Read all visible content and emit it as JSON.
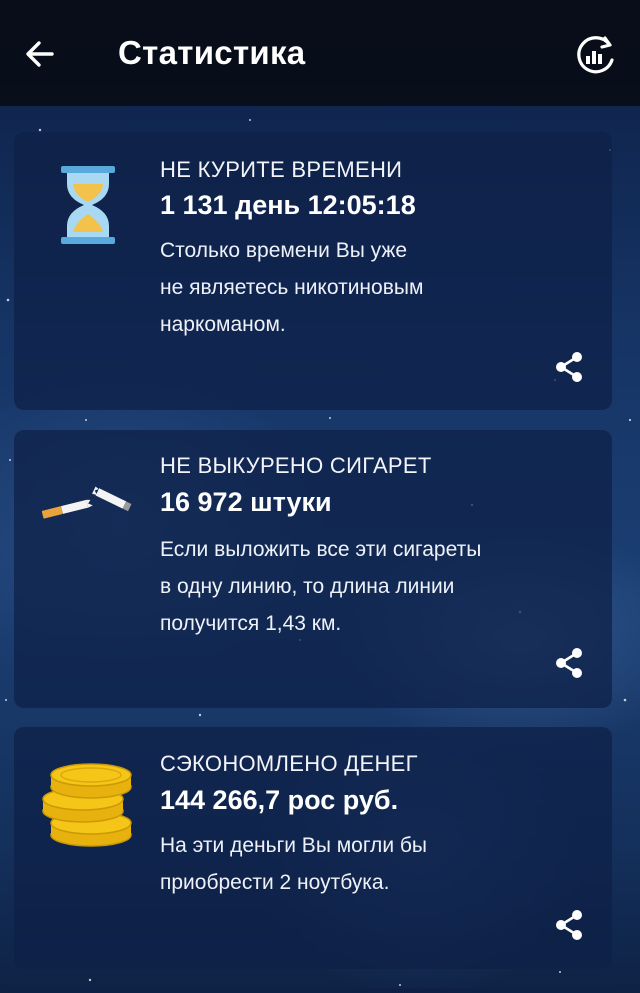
{
  "header": {
    "title": "Статистика",
    "back_icon": "arrow-back-icon",
    "action_icon": "refresh-chart-icon"
  },
  "cards": [
    {
      "icon": "hourglass-icon",
      "heading": "НЕ КУРИТЕ ВРЕМЕНИ",
      "value": "1 131 день 12:05:18",
      "description": [
        "Столько времени Вы уже",
        "не являетесь никотиновым",
        "наркоманом."
      ],
      "share_icon": "share-icon"
    },
    {
      "icon": "broken-cigarette-icon",
      "heading": "НЕ ВЫКУРЕНО СИГАРЕТ",
      "value": "16 972 штуки",
      "description": [
        "Если выложить все эти сигареты",
        "в одну линию, то длина линии",
        "получится 1,43 км."
      ],
      "share_icon": "share-icon"
    },
    {
      "icon": "coins-stack-icon",
      "heading": "СЭКОНОМЛЕНО ДЕНЕГ",
      "value": "144 266,7 рос руб.",
      "description": [
        "На эти деньги Вы могли бы",
        "приобрести 2 ноутбука."
      ],
      "share_icon": "share-icon"
    }
  ],
  "colors": {
    "appbar": "#080c16",
    "card": "#0e2046",
    "text": "#ffffff",
    "hourglass_frame": "#5aa9dc",
    "sand": "#f2c24a",
    "coin": "#f5c518",
    "cigarette_filter": "#e8a33a"
  }
}
